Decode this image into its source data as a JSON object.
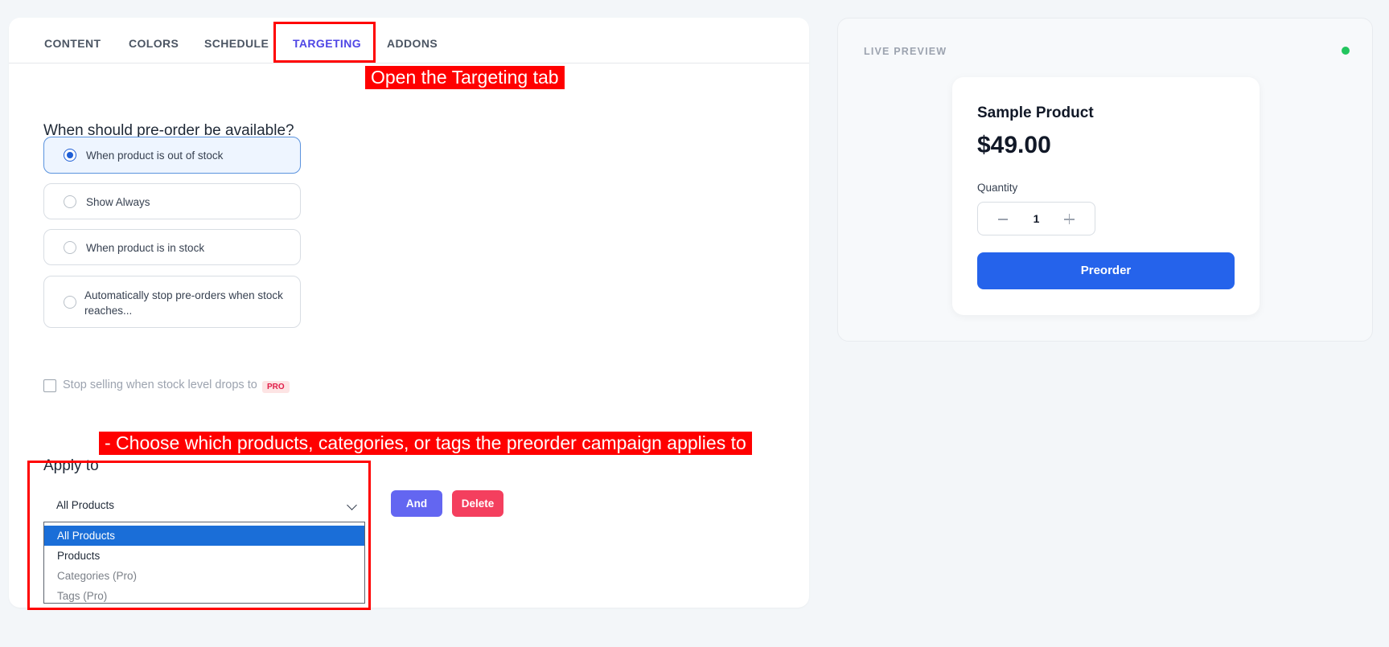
{
  "tabs": [
    {
      "label": "CONTENT"
    },
    {
      "label": "COLORS"
    },
    {
      "label": "SCHEDULE"
    },
    {
      "label": "TARGETING"
    },
    {
      "label": "ADDONS"
    }
  ],
  "active_tab": "TARGETING",
  "annotations": {
    "targeting_tab": "Open the Targeting tab",
    "apply_to": "- Choose which products, categories, or tags the preorder campaign applies to"
  },
  "availability": {
    "question": "When should pre-order be available?",
    "options": [
      {
        "label": "When product is out of stock",
        "selected": true
      },
      {
        "label": "Show Always",
        "selected": false
      },
      {
        "label": "When product is in stock",
        "selected": false
      },
      {
        "label": "Automatically stop pre-orders when stock",
        "label_line2": "reaches...",
        "selected": false
      }
    ]
  },
  "stop_selling": {
    "label": "Stop selling when stock level drops to",
    "badge": "PRO",
    "checked": false
  },
  "apply_to": {
    "label": "Apply to",
    "selected": "All Products",
    "options": [
      "All Products",
      "Products",
      "Categories (Pro)",
      "Tags (Pro)"
    ],
    "and_button": "And",
    "delete_button": "Delete"
  },
  "preview": {
    "title": "LIVE PREVIEW",
    "product_name": "Sample Product",
    "price": "$49.00",
    "quantity_label": "Quantity",
    "quantity": "1",
    "button": "Preorder"
  },
  "colors": {
    "accent": "#4f46e5",
    "primary_button": "#2563eb",
    "and_button": "#6366f1",
    "delete_button": "#f43f5e",
    "live_dot": "#22c55e",
    "annotation": "#ff0000"
  }
}
